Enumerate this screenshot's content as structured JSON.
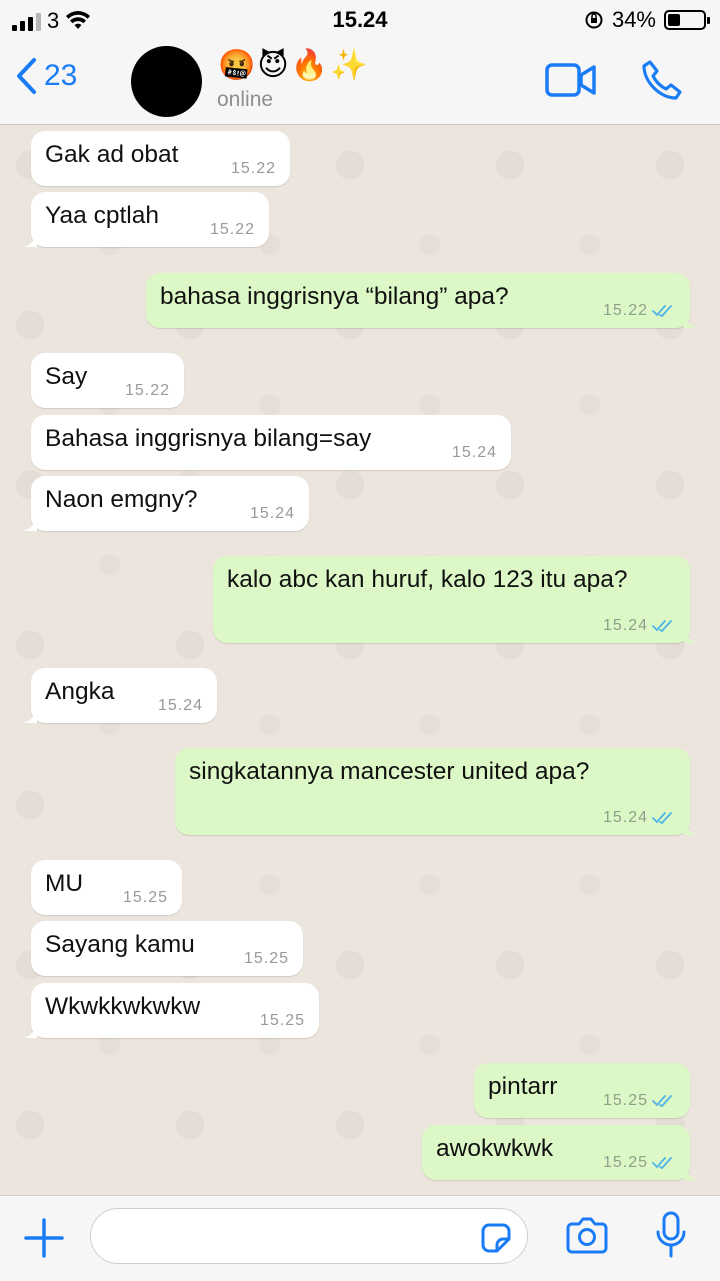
{
  "status": {
    "carrier": "3",
    "time": "15.24",
    "battery": "34%",
    "battery_level": 0.34
  },
  "header": {
    "back_count": "23",
    "contact_name": "🤬😈🔥✨",
    "presence": "online"
  },
  "messages": [
    {
      "dir": "in",
      "text": "Gak ad obat",
      "time": "15.22"
    },
    {
      "dir": "in",
      "text": "Yaa cptlah",
      "time": "15.22"
    },
    {
      "dir": "out",
      "text": "bahasa inggrisnya “bilang” apa?",
      "time": "15.22"
    },
    {
      "dir": "in",
      "text": "Say",
      "time": "15.22"
    },
    {
      "dir": "in",
      "text": "Bahasa inggrisnya bilang=say",
      "time": "15.24"
    },
    {
      "dir": "in",
      "text": "Naon emgny?",
      "time": "15.24"
    },
    {
      "dir": "out",
      "text": "kalo abc kan huruf, kalo 123 itu apa?",
      "time": "15.24"
    },
    {
      "dir": "in",
      "text": "Angka",
      "time": "15.24"
    },
    {
      "dir": "out",
      "text": "singkatannya mancester united apa?",
      "time": "15.24"
    },
    {
      "dir": "in",
      "text": "MU",
      "time": "15.25"
    },
    {
      "dir": "in",
      "text": "Sayang kamu",
      "time": "15.25"
    },
    {
      "dir": "in",
      "text": "Wkwkkwkwkw",
      "time": "15.25"
    },
    {
      "dir": "out",
      "text": "pintarr",
      "time": "15.25"
    },
    {
      "dir": "out",
      "text": "awokwkwk",
      "time": "15.25"
    }
  ],
  "composer": {
    "placeholder": ""
  },
  "colors": {
    "accent": "#1a7cf5",
    "out_bubble": "#dcf8c6",
    "in_bubble": "#ffffff",
    "read_tick": "#4fb3e8"
  }
}
